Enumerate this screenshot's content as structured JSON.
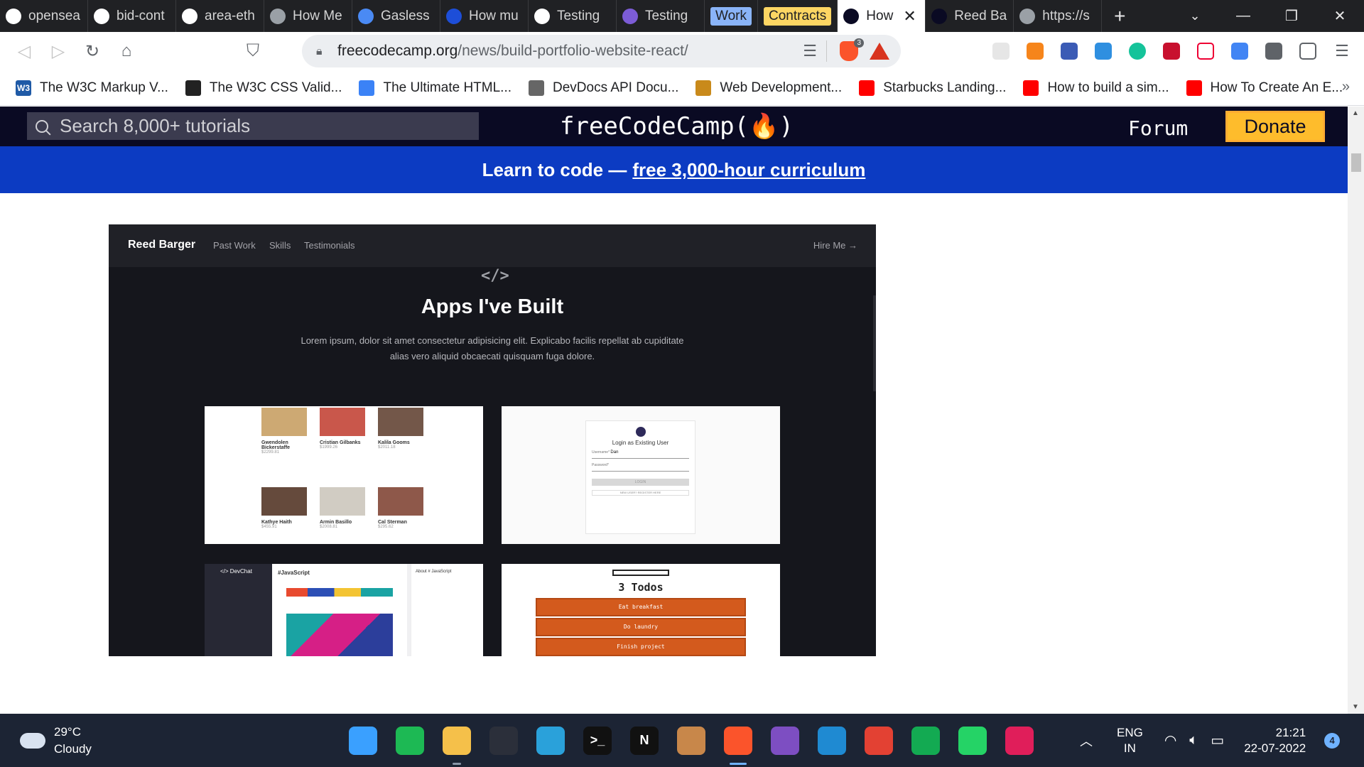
{
  "tabs": [
    {
      "label": "opensea",
      "icon": "github-icon",
      "color": "#ffffff"
    },
    {
      "label": "bid-cont",
      "icon": "github-icon",
      "color": "#ffffff"
    },
    {
      "label": "area-eth",
      "icon": "github-icon",
      "color": "#ffffff"
    },
    {
      "label": "How Me",
      "icon": "globe-icon",
      "color": "#9aa0a6"
    },
    {
      "label": "Gasless",
      "icon": "docs-icon",
      "color": "#4a8af4"
    },
    {
      "label": "How mu",
      "icon": "fe-icon",
      "color": "#1d4ed8"
    },
    {
      "label": "Testing",
      "icon": "notion-icon",
      "color": "#ffffff"
    },
    {
      "label": "Testing",
      "icon": "rocket-icon",
      "color": "#7c5cd6"
    }
  ],
  "tab_groups": [
    {
      "label": "Work",
      "color": "#8ab4f8"
    },
    {
      "label": "Contracts",
      "color": "#fdd663"
    }
  ],
  "active_tab": {
    "label": "How",
    "icon": "freecodecamp-icon"
  },
  "after_tabs": [
    {
      "label": "Reed Ba",
      "icon": "freecodecamp-icon"
    },
    {
      "label": "https://s",
      "icon": "globe-icon"
    }
  ],
  "address": {
    "host": "freecodecamp.org",
    "path": "/news/build-portfolio-website-react/",
    "shield_count": "3"
  },
  "bookmarks": [
    {
      "label": "The W3C Markup V...",
      "icon": "w3c-icon",
      "color": "#1f5aa6",
      "glyph": "W3"
    },
    {
      "label": "The W3C CSS Valid...",
      "icon": "css-validator-icon",
      "color": "#222222",
      "glyph": ""
    },
    {
      "label": "The Ultimate HTML...",
      "icon": "shield-icon",
      "color": "#3b82f6",
      "glyph": ""
    },
    {
      "label": "DevDocs API Docu...",
      "icon": "devdocs-icon",
      "color": "#666666",
      "glyph": ""
    },
    {
      "label": "Web Development...",
      "icon": "bookmark-icon",
      "color": "#c98a1b",
      "glyph": ""
    },
    {
      "label": "Starbucks Landing...",
      "icon": "youtube-icon",
      "color": "#ff0000",
      "glyph": ""
    },
    {
      "label": "How to build a sim...",
      "icon": "youtube-icon",
      "color": "#ff0000",
      "glyph": ""
    },
    {
      "label": "How To Create An E...",
      "icon": "youtube-icon",
      "color": "#ff0000",
      "glyph": ""
    }
  ],
  "fcc": {
    "search_placeholder": "Search 8,000+ tutorials",
    "logo": "freeCodeCamp(🔥)",
    "forum": "Forum",
    "donate": "Donate",
    "banner_prefix": "Learn to code —",
    "banner_link": "free 3,000-hour curriculum"
  },
  "portfolio": {
    "brand": "Reed Barger",
    "nav": [
      "Past Work",
      "Skills",
      "Testimonials"
    ],
    "hire": "Hire Me →",
    "code_glyph": "</>",
    "title": "Apps I've Built",
    "description": "Lorem ipsum, dolor sit amet consectetur adipisicing elit. Explicabo facilis repellat ab cupiditate alias vero aliquid obcaecati quisquam fuga dolore.",
    "products": [
      {
        "name": "Gwendolen Bickerstaffe",
        "price": "$2299.81",
        "color": "#c49a5a"
      },
      {
        "name": "Cristian Gilbanks",
        "price": "$1999.26",
        "color": "#c0392b"
      },
      {
        "name": "Kalila Gooms",
        "price": "$2011.18",
        "color": "#5b3a29"
      },
      {
        "name": "Kathye Haith",
        "price": "$455.91",
        "color": "#4a2a1a"
      },
      {
        "name": "Armin Basillo",
        "price": "$2008.81",
        "color": "#c9c3b8"
      },
      {
        "name": "Cal Sterman",
        "price": "$295.62",
        "color": "#7a3b2a"
      }
    ],
    "login": {
      "title": "Login as Existing User",
      "username_label": "Username*",
      "username_value": "Dan",
      "password_label": "Password*",
      "button": "LOGIN",
      "register": "NEW USER? REGISTER HERE"
    },
    "devchat": {
      "brand": "</> DevChat",
      "channel": "#JavaScript",
      "about": "About # JavaScript"
    },
    "todos": {
      "title": "3 Todos",
      "items": [
        "Eat breakfast",
        "Do laundry",
        "Finish project"
      ]
    }
  },
  "taskbar": {
    "temp": "29°C",
    "condition": "Cloudy",
    "apps": [
      {
        "name": "windows-start",
        "color": "#3aa0ff",
        "glyph": "",
        "running": false
      },
      {
        "name": "spotify",
        "color": "#1db954",
        "glyph": "",
        "running": false
      },
      {
        "name": "file-explorer",
        "color": "#f5c04a",
        "glyph": "",
        "running": true
      },
      {
        "name": "speedometer",
        "color": "#2b2f3a",
        "glyph": "",
        "running": false
      },
      {
        "name": "telegram",
        "color": "#2aa1da",
        "glyph": "",
        "running": false
      },
      {
        "name": "terminal",
        "color": "#111111",
        "glyph": ">_",
        "running": false
      },
      {
        "name": "netflix",
        "color": "#111111",
        "glyph": "N",
        "running": false
      },
      {
        "name": "package",
        "color": "#c8874a",
        "glyph": "",
        "running": false
      },
      {
        "name": "brave",
        "color": "#fb542b",
        "glyph": "",
        "running": true,
        "focused": true
      },
      {
        "name": "github-desktop",
        "color": "#7d4ec2",
        "glyph": "",
        "running": false
      },
      {
        "name": "vscode",
        "color": "#1f8ad2",
        "glyph": "",
        "running": false
      },
      {
        "name": "chrome",
        "color": "#e34133",
        "glyph": "",
        "running": false
      },
      {
        "name": "mongodb-compass",
        "color": "#13aa52",
        "glyph": "",
        "running": false
      },
      {
        "name": "whatsapp",
        "color": "#25d366",
        "glyph": "",
        "running": false
      },
      {
        "name": "slack",
        "color": "#e01e5a",
        "glyph": "",
        "running": false
      }
    ],
    "lang_top": "ENG",
    "lang_bottom": "IN",
    "time": "21:21",
    "date": "22-07-2022",
    "notifications": "4"
  }
}
